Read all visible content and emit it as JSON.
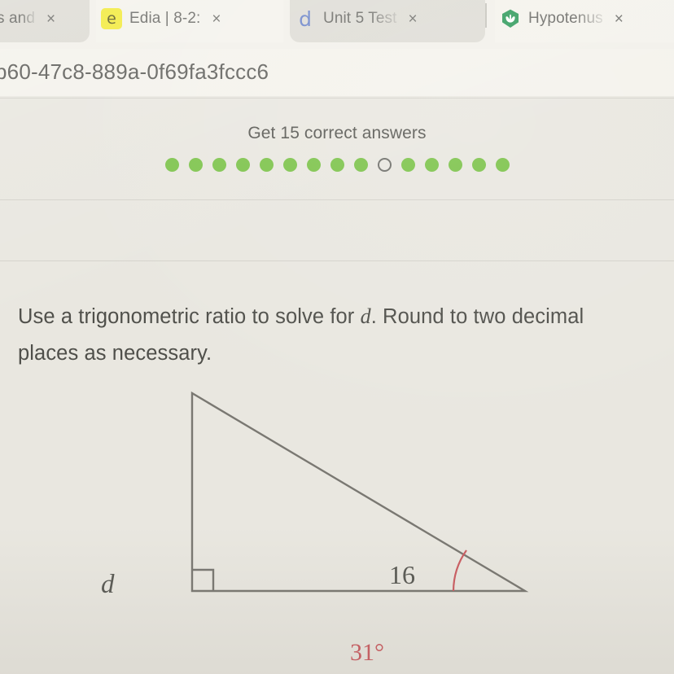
{
  "browser": {
    "tabs": [
      {
        "title": "s and",
        "favicon": "none-icon",
        "state": "inactive",
        "close_label": "×"
      },
      {
        "title": "Edia | 8-2:",
        "favicon": "edia-e-icon",
        "favicon_letter": "e",
        "state": "active",
        "close_label": "×"
      },
      {
        "title": "Unit 5 Test",
        "favicon": "desmos-d-icon",
        "favicon_letter": "d",
        "state": "inactive",
        "close_label": "×"
      },
      {
        "title": "Hypotenus",
        "favicon": "brainly-icon",
        "state": "active",
        "close_label": "×"
      }
    ],
    "url": "b60-47c8-889a-0f69fa3fccc6"
  },
  "progress": {
    "title": "Get 15 correct answers",
    "total": 15,
    "completed": 9,
    "current_index": 9,
    "dot_states": [
      "filled",
      "filled",
      "filled",
      "filled",
      "filled",
      "filled",
      "filled",
      "filled",
      "filled",
      "current",
      "filled",
      "filled",
      "filled",
      "filled",
      "filled"
    ]
  },
  "question": {
    "line1_before": "Use a trigonometric ratio to solve for ",
    "variable": "d",
    "line1_after": ". Round to two decimal",
    "line2": "places as necessary."
  },
  "figure": {
    "type": "right-triangle",
    "leg_vertical_label": "d",
    "hypotenuse_label": "16",
    "angle_label": "31°",
    "right_angle_marker": true,
    "angle_color": "#cb5f64",
    "stroke_color": "#7a7872"
  },
  "colors": {
    "page_background": "#e9e7e0",
    "tab_active_background": "#f4f2ec",
    "tab_inactive_background": "#dedcd5",
    "progress_dot_filled": "#7cc34a",
    "progress_dot_current_border": "#6f6f6a",
    "text_primary": "#4f4f4a",
    "accent_red": "#cb5f64"
  }
}
